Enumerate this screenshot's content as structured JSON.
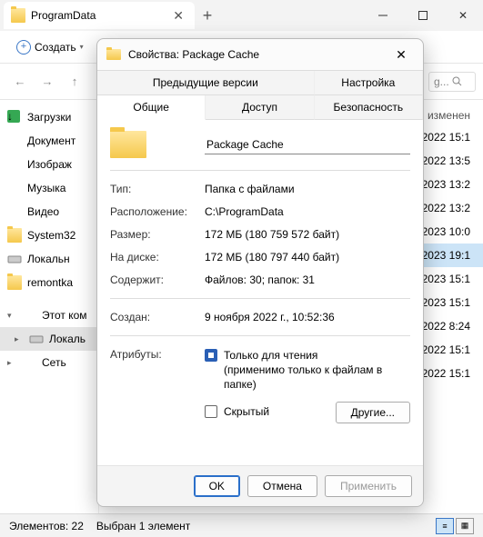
{
  "window": {
    "tab_title": "ProgramData",
    "create_label": "Создать"
  },
  "column_header": "изменен",
  "dates": [
    ".2022 15:1",
    ".2022 13:5",
    ".2023 13:2",
    ".2022 13:2",
    ".2023 10:0",
    ".2023 19:1",
    ".2023 15:1",
    ".2023 15:1",
    ".2022 8:24",
    ".2022 15:1",
    ".2022 15:1"
  ],
  "selected_date_index": 5,
  "sidebar": {
    "items": [
      {
        "label": "Загрузки",
        "kind": "dl"
      },
      {
        "label": "Документ",
        "kind": "doc"
      },
      {
        "label": "Изображ",
        "kind": "img"
      },
      {
        "label": "Музыка",
        "kind": "mus"
      },
      {
        "label": "Видео",
        "kind": "vid"
      },
      {
        "label": "System32",
        "kind": "folder"
      },
      {
        "label": "Локальн",
        "kind": "disk"
      },
      {
        "label": "remontka",
        "kind": "folder"
      }
    ],
    "tree": [
      {
        "label": "Этот ком",
        "kind": "pc",
        "expanded": true
      },
      {
        "label": "Локаль",
        "kind": "disk",
        "selected": true,
        "indent": true
      },
      {
        "label": "Сеть",
        "kind": "net"
      }
    ]
  },
  "statusbar": {
    "count": "Элементов: 22",
    "selected": "Выбран 1 элемент"
  },
  "search_placeholder": "g...",
  "dialog": {
    "title": "Свойства: Package Cache",
    "tabs_top": [
      "Предыдущие версии",
      "Настройка"
    ],
    "tabs_bottom": [
      "Общие",
      "Доступ",
      "Безопасность"
    ],
    "active_tab": "Общие",
    "name_value": "Package Cache",
    "rows": {
      "type_label": "Тип:",
      "type_value": "Папка с файлами",
      "location_label": "Расположение:",
      "location_value": "C:\\ProgramData",
      "size_label": "Размер:",
      "size_value": "172 МБ (180 759 572 байт)",
      "disk_label": "На диске:",
      "disk_value": "172 МБ (180 797 440 байт)",
      "contains_label": "Содержит:",
      "contains_value": "Файлов: 30; папок: 31",
      "created_label": "Создан:",
      "created_value": "9 ноября 2022 г., 10:52:36",
      "attrs_label": "Атрибуты:"
    },
    "attrs": {
      "readonly_label": "Только для чтения",
      "readonly_note": "(применимо только к файлам в папке)",
      "hidden_label": "Скрытый",
      "other_button": "Другие..."
    },
    "buttons": {
      "ok": "OK",
      "cancel": "Отмена",
      "apply": "Применить"
    }
  }
}
